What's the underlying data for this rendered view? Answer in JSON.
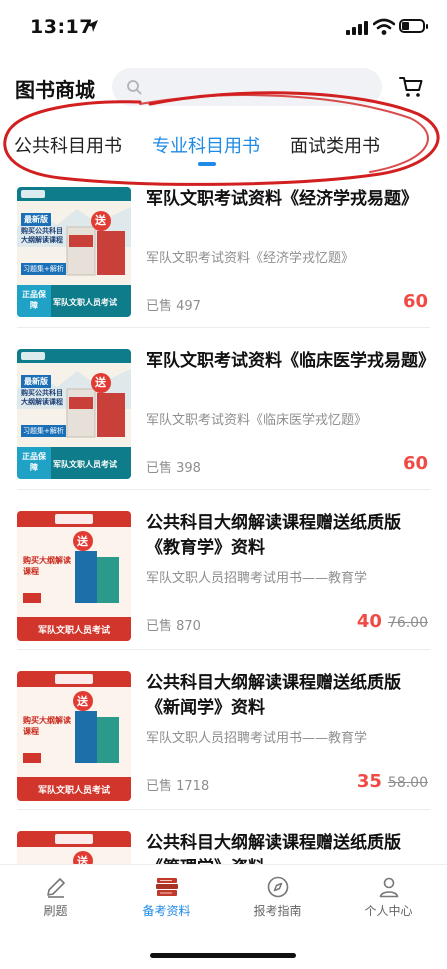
{
  "status": {
    "time": "13:17"
  },
  "header": {
    "title": "图书商城",
    "search_placeholder": ""
  },
  "tabs": [
    {
      "label": "公共科目用书"
    },
    {
      "label": "专业科目用书"
    },
    {
      "label": "面试类用书"
    }
  ],
  "active_tab": 1,
  "colors": {
    "accent": "#1e8be6",
    "price": "#ef4b44",
    "annotation": "#d21f1f"
  },
  "products": [
    {
      "title": "军队文职考试资料《经济学戎易题》",
      "subtitle": "军队文职考试资料《经济学戎忆题》",
      "sold": "已售 497",
      "price": "60",
      "original_price": "",
      "cover": {
        "badge_new": "最新版",
        "gift": "送",
        "book_title": "购买公共科目大纲解读课程",
        "tag": "习题集+解析",
        "footer": "军队文职人员考试",
        "quality": "正品保障"
      }
    },
    {
      "title": "军队文职考试资料《临床医学戎易题》",
      "subtitle": "军队文职考试资料《临床医学戎忆题》",
      "sold": "已售 398",
      "price": "60",
      "original_price": "",
      "cover": {
        "badge_new": "最新版",
        "gift": "送",
        "book_title": "购买公共科目大纲解读课程",
        "tag": "习题集+解析",
        "footer": "军队文职人员考试",
        "quality": "正品保障"
      }
    },
    {
      "title": "公共科目大纲解读课程赠送纸质版《教育学》资料",
      "subtitle": "军队文职人员招聘考试用书——教育学",
      "sold": "已售 870",
      "price": "40",
      "original_price": "76.00",
      "cover": {
        "gift": "送",
        "book_title": "购买大纲解读课程",
        "footer": "军队文职人员考试"
      }
    },
    {
      "title": "公共科目大纲解读课程赠送纸质版《新闻学》资料",
      "subtitle": "军队文职人员招聘考试用书——教育学",
      "sold": "已售 1718",
      "price": "35",
      "original_price": "58.00",
      "cover": {
        "gift": "送",
        "book_title": "购买大纲解读课程",
        "footer": "军队文职人员考试"
      }
    },
    {
      "title": "公共科目大纲解读课程赠送纸质版《管理学》资料",
      "subtitle": "",
      "sold": "",
      "price": "",
      "original_price": "",
      "cover": {
        "gift": "送",
        "book_title": "",
        "footer": ""
      }
    }
  ],
  "tabbar": [
    {
      "label": "刷题",
      "icon": "pencil-icon"
    },
    {
      "label": "备考资料",
      "icon": "books-icon"
    },
    {
      "label": "报考指南",
      "icon": "compass-icon"
    },
    {
      "label": "个人中心",
      "icon": "person-icon"
    }
  ]
}
